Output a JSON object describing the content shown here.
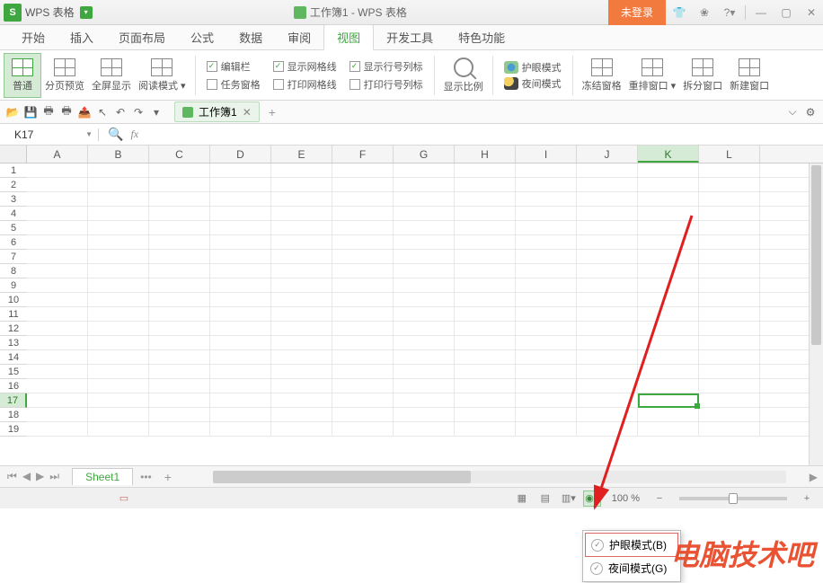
{
  "app": {
    "short": "S",
    "name": "WPS 表格",
    "doc_title": "工作簿1 - WPS 表格"
  },
  "title_actions": {
    "login": "未登录"
  },
  "menu": {
    "items": [
      "开始",
      "插入",
      "页面布局",
      "公式",
      "数据",
      "审阅",
      "视图",
      "开发工具",
      "特色功能"
    ],
    "active_index": 6
  },
  "ribbon": {
    "view_buttons": [
      {
        "label": "普通",
        "active": true
      },
      {
        "label": "分页预览",
        "active": false
      },
      {
        "label": "全屏显示",
        "active": false
      },
      {
        "label": "阅读模式 ▾",
        "active": false
      }
    ],
    "checks_col1": [
      {
        "label": "编辑栏",
        "checked": true
      },
      {
        "label": "任务窗格",
        "checked": false
      }
    ],
    "checks_col2": [
      {
        "label": "显示网格线",
        "checked": true
      },
      {
        "label": "打印网格线",
        "checked": false
      }
    ],
    "checks_col3": [
      {
        "label": "显示行号列标",
        "checked": true
      },
      {
        "label": "打印行号列标",
        "checked": false
      }
    ],
    "zoom_btn": "显示比例",
    "modes": [
      {
        "label": "护眼模式"
      },
      {
        "label": "夜间模式"
      }
    ],
    "window_btns": [
      "冻结窗格",
      "重排窗口 ▾",
      "拆分窗口",
      "新建窗口"
    ]
  },
  "doc_tab": {
    "name": "工作簿1"
  },
  "name_box": "K17",
  "fx_label": "fx",
  "columns": [
    "A",
    "B",
    "C",
    "D",
    "E",
    "F",
    "G",
    "H",
    "I",
    "J",
    "K",
    "L"
  ],
  "active_col_index": 10,
  "rows": [
    "1",
    "2",
    "3",
    "4",
    "5",
    "6",
    "7",
    "8",
    "9",
    "10",
    "11",
    "12",
    "13",
    "14",
    "15",
    "16",
    "17",
    "18",
    "19"
  ],
  "active_row_index": 16,
  "sheet": {
    "name": "Sheet1",
    "more": "•••",
    "add": "+"
  },
  "status": {
    "zoom": "100 %"
  },
  "popup": {
    "items": [
      {
        "label": "护眼模式(B)",
        "selected": true
      },
      {
        "label": "夜间模式(G)",
        "selected": false
      }
    ]
  },
  "watermark": "电脑技术吧"
}
